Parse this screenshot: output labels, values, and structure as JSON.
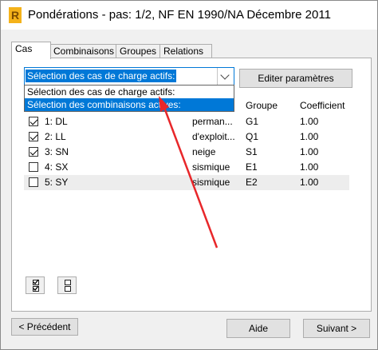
{
  "window": {
    "title": "Pondérations - pas: 1/2, NF EN 1990/NA Décembre 2011",
    "app_icon": "R"
  },
  "tabs": [
    {
      "label": "Cas",
      "active": true
    },
    {
      "label": "Combinaisons",
      "active": false
    },
    {
      "label": "Groupes",
      "active": false
    },
    {
      "label": "Relations",
      "active": false
    }
  ],
  "selector": {
    "value": "Sélection des cas de charge actifs:",
    "options": [
      "Sélection des cas de charge actifs:",
      "Sélection des combinaisons actives:"
    ],
    "highlighted_option": 1
  },
  "edit_button": "Editer paramètres",
  "grid": {
    "headers": {
      "group": "Groupe",
      "coefficient": "Coefficient"
    },
    "rows": [
      {
        "checked": true,
        "name": "1: DL",
        "nature": "perman...",
        "group": "G1",
        "coef": "1.00"
      },
      {
        "checked": true,
        "name": "2: LL",
        "nature": "d'exploit...",
        "group": "Q1",
        "coef": "1.00"
      },
      {
        "checked": true,
        "name": "3: SN",
        "nature": "neige",
        "group": "S1",
        "coef": "1.00"
      },
      {
        "checked": false,
        "name": "4: SX",
        "nature": "sismique",
        "group": "E1",
        "coef": "1.00"
      },
      {
        "checked": false,
        "name": "5: SY",
        "nature": "sismique",
        "group": "E2",
        "coef": "1.00"
      }
    ]
  },
  "icons": {
    "select_all": "check-all-icon",
    "select_none": "uncheck-all-icon"
  },
  "footer": {
    "prev": "< Précédent",
    "help": "Aide",
    "next": "Suivant >"
  },
  "annotation_color": "#e8272a"
}
